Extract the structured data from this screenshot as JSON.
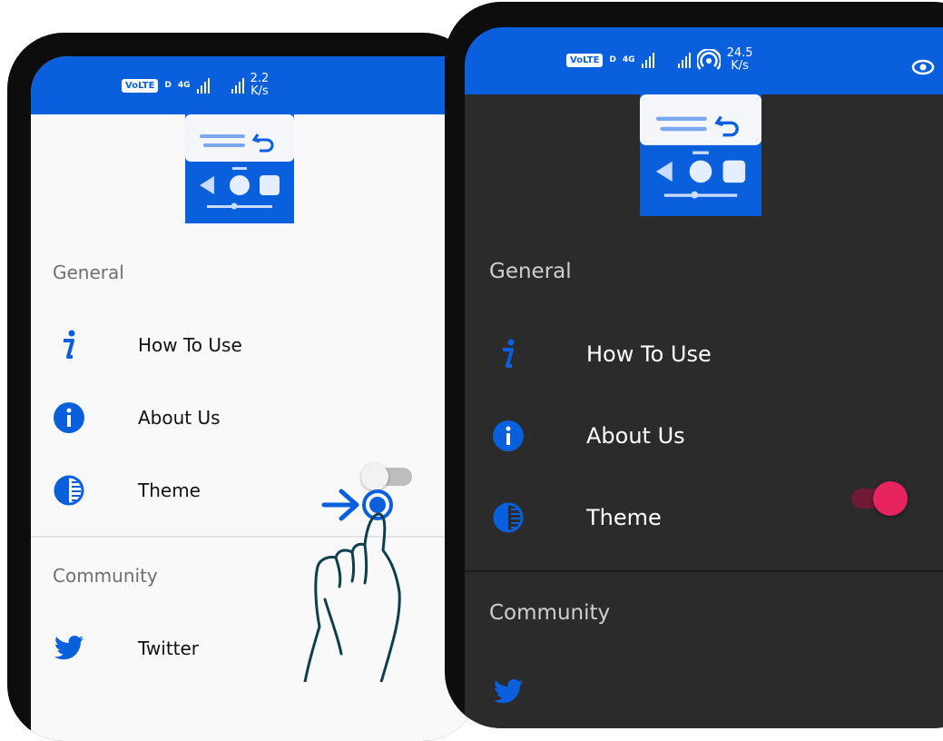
{
  "status_light": {
    "network": "4G",
    "speed_value": "2.2",
    "speed_unit": "K/s",
    "volte": "VoLTE",
    "sim": "D"
  },
  "status_dark": {
    "network": "4G",
    "speed_value": "24.5",
    "speed_unit": "K/s",
    "volte": "VoLTE",
    "sim": "D"
  },
  "menu": {
    "general_header": "General",
    "how_to_use": "How To Use",
    "about_us": "About Us",
    "theme": "Theme",
    "community_header": "Community",
    "twitter": "Twitter"
  },
  "theme_toggle_light": {
    "state": "off"
  },
  "theme_toggle_dark": {
    "state": "on"
  },
  "colors": {
    "accent": "#0a5fdc",
    "toggle_on": "#e8245f",
    "dark_bg": "#2b2b2b",
    "light_bg": "#f9f9f9"
  },
  "icons": [
    "info-italic-icon",
    "info-circle-icon",
    "theme-contrast-icon",
    "twitter-icon",
    "eye-icon",
    "arrow-right-icon",
    "pointing-hand-icon",
    "app-logo"
  ]
}
